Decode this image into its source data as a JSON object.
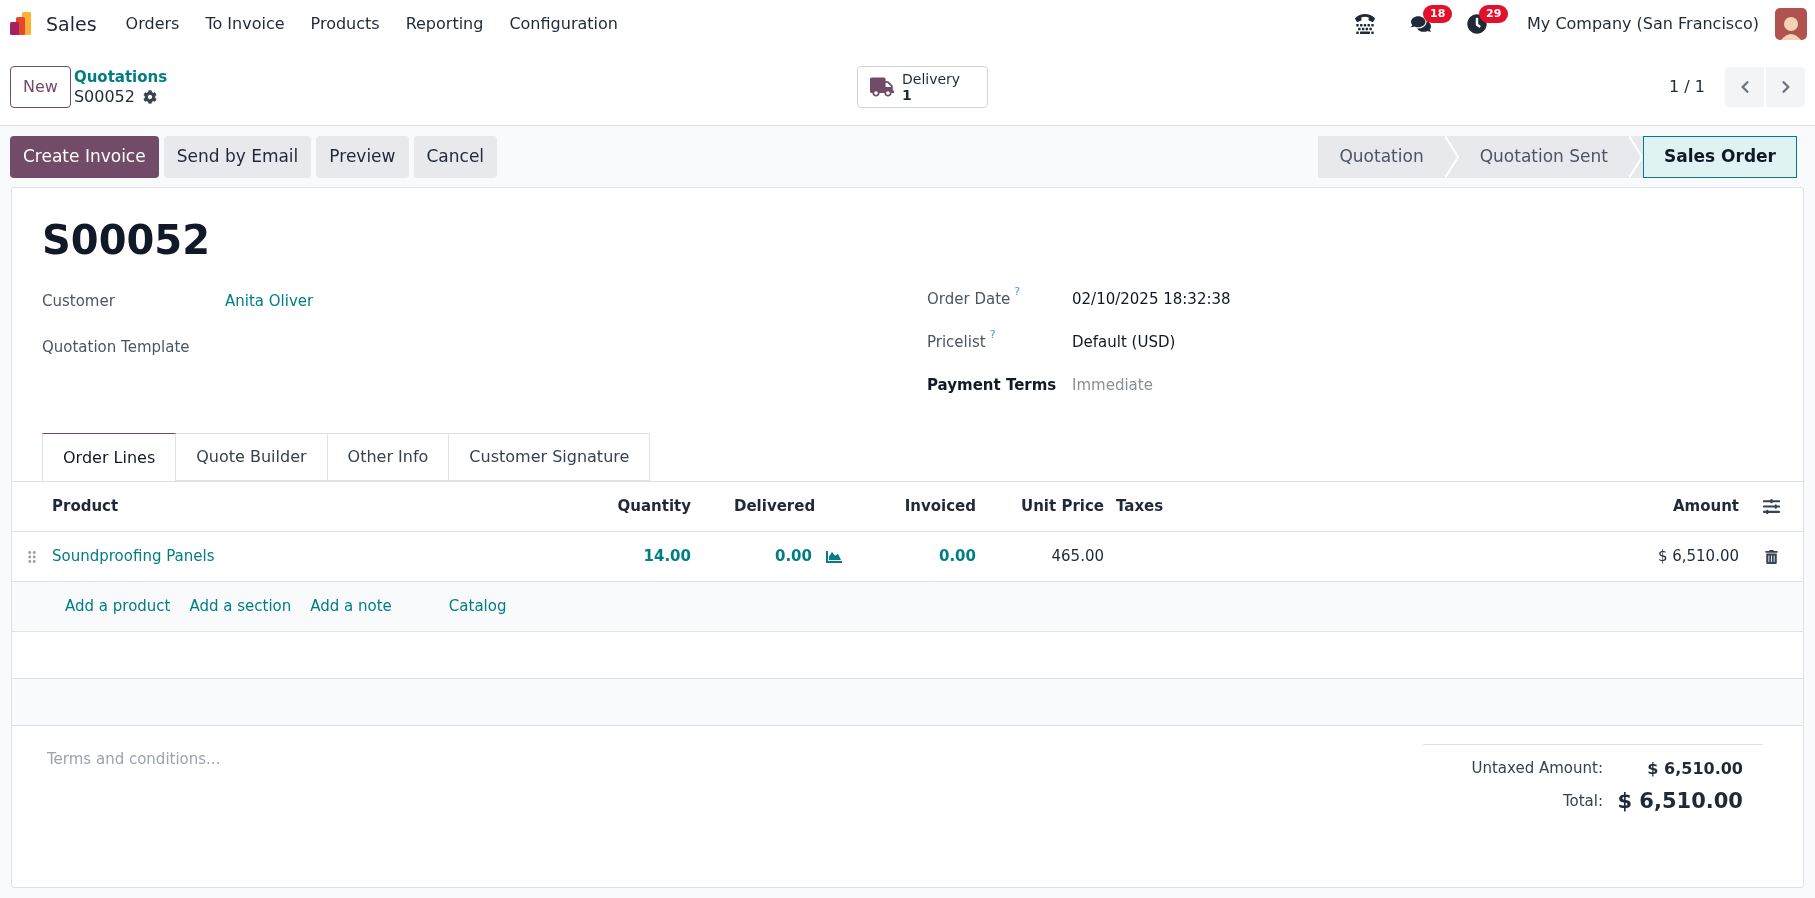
{
  "navbar": {
    "app_name": "Sales",
    "menu": [
      "Orders",
      "To Invoice",
      "Products",
      "Reporting",
      "Configuration"
    ],
    "systray": [
      {
        "kind": "phone"
      },
      {
        "kind": "messages",
        "badge": "18"
      },
      {
        "kind": "activities",
        "badge": "29"
      }
    ],
    "company": "My Company (San Francisco)"
  },
  "control_panel": {
    "new_button": "New",
    "breadcrumb": {
      "parent": "Quotations",
      "current": "S00052"
    },
    "smart_button": {
      "label": "Delivery",
      "value": "1"
    },
    "pager": "1 / 1"
  },
  "actions": [
    {
      "label": "Create Invoice",
      "kind": "primary"
    },
    {
      "label": "Send by Email",
      "kind": "secondary"
    },
    {
      "label": "Preview",
      "kind": "secondary"
    },
    {
      "label": "Cancel",
      "kind": "secondary"
    }
  ],
  "stages": [
    {
      "label": "Quotation",
      "selected": false
    },
    {
      "label": "Quotation Sent",
      "selected": false
    },
    {
      "label": "Sales Order",
      "selected": true
    }
  ],
  "form": {
    "title": "S00052",
    "left_fields": [
      {
        "label": "Customer",
        "value": "Anita Oliver",
        "kind": "link"
      },
      {
        "label": "Quotation Template",
        "kind": "empty"
      }
    ],
    "right_fields": [
      {
        "label": "Order Date",
        "help": "?",
        "value": "02/10/2025 18:32:38",
        "kind": "text"
      },
      {
        "label": "Pricelist",
        "help": "?",
        "value": "Default (USD)",
        "kind": "text"
      },
      {
        "label": "Payment Terms",
        "placeholder": "Immediate",
        "kind": "placeholder",
        "required": true
      }
    ]
  },
  "tabs": [
    {
      "label": "Order Lines",
      "selected": true
    },
    {
      "label": "Quote Builder",
      "selected": false
    },
    {
      "label": "Other Info",
      "selected": false
    },
    {
      "label": "Customer Signature",
      "selected": false
    }
  ],
  "table": {
    "columns": [
      "Product",
      "Quantity",
      "Delivered",
      "Invoiced",
      "Unit Price",
      "Taxes",
      "Amount"
    ],
    "rows": [
      {
        "product": "Soundproofing Panels",
        "quantity": "14.00",
        "delivered": "0.00",
        "invoiced": "0.00",
        "unit_price": "465.00",
        "amount": "$ 6,510.00"
      }
    ],
    "add_links": [
      "Add a product",
      "Add a section",
      "Add a note",
      "Catalog"
    ]
  },
  "terms_placeholder": "Terms and conditions...",
  "totals": [
    {
      "label": "Untaxed Amount:",
      "value": "$ 6,510.00",
      "kind": "subtotal"
    },
    {
      "label": "Total:",
      "value": "$ 6,510.00",
      "kind": "total"
    }
  ]
}
